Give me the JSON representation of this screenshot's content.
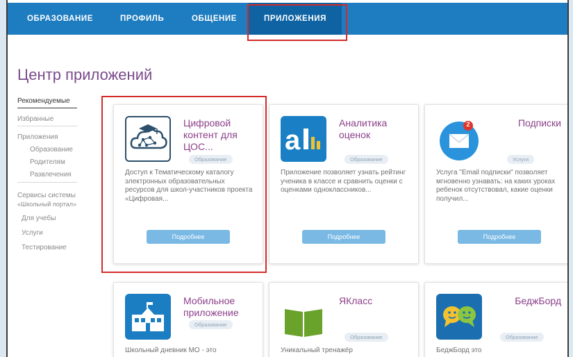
{
  "topnav": {
    "items": [
      "ОБРАЗОВАНИЕ",
      "ПРОФИЛЬ",
      "ОБЩЕНИЕ",
      "ПРИЛОЖЕНИЯ"
    ],
    "active": "ПРИЛОЖЕНИЯ"
  },
  "page": {
    "title": "Центр приложений"
  },
  "sidebar": {
    "recommended": "Рекомендуемые",
    "favorites": "Избранные",
    "apps": "Приложения",
    "apps_items": [
      "Образование",
      "Родителям",
      "Развлечения"
    ],
    "services_line1": "Сервисы системы",
    "services_line2": "«Школьный портал»",
    "services_items": [
      "Для учебы",
      "Услуги",
      "Тестирование"
    ]
  },
  "cards": [
    {
      "title_l1": "Цифровой",
      "title_l2": "контент для",
      "title_l3": "ЦОС...",
      "badge": "Образование",
      "desc": "Доступ к Тематическому каталогу электронных образовательных ресурсов для школ-участников проекта «Цифровая...",
      "button": "Подробнее",
      "icon": "cloud-graduation-icon"
    },
    {
      "title_l1": "Аналитика",
      "title_l2": "оценок",
      "badge": "Образование",
      "desc": "Приложение позволяет узнать рейтинг ученика в классе и сравнить оценки с оценками одноклассников...",
      "button": "Подробнее",
      "icon": "analytics-logo-icon"
    },
    {
      "title_l1": "Подписки",
      "badge": "Услуги",
      "desc": "Услуга \"Email подписки\" позволяет мгновенно узнавать: на каких уроках ребенок отсутствовал, какие оценки получил...",
      "button": "Подробнее",
      "icon": "mail-notification-icon",
      "notif": "2"
    },
    {
      "title_l1": "Мобильное",
      "title_l2": "приложение",
      "badge": "Образование",
      "desc": "Школьный дневник МО - это",
      "icon": "school-building-icon"
    },
    {
      "title_l1": "ЯКласс",
      "badge": "Образование",
      "desc": "Уникальный тренажёр",
      "icon": "open-book-icon"
    },
    {
      "title_l1": "БеджБорд",
      "badge": "Образование",
      "desc": "БеджБорд это",
      "icon": "chat-smiles-icon"
    }
  ],
  "colors": {
    "nav": "#1e7dc0",
    "nav_active": "#0f63a3",
    "title": "#7a4b8c",
    "card_title": "#8b3f8a",
    "button": "#7ab9e4",
    "highlight": "#d42a2a"
  }
}
